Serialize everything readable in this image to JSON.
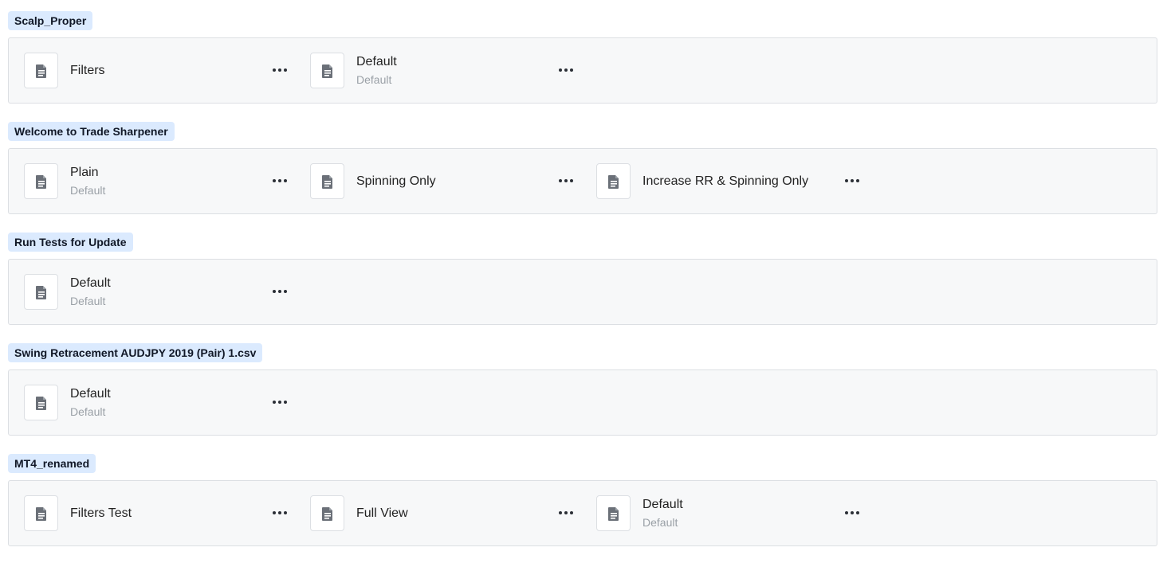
{
  "groups": [
    {
      "name": "Scalp_Proper",
      "items": [
        {
          "title": "Filters",
          "subtitle": ""
        },
        {
          "title": "Default",
          "subtitle": "Default"
        }
      ]
    },
    {
      "name": "Welcome to Trade Sharpener",
      "items": [
        {
          "title": "Plain",
          "subtitle": "Default"
        },
        {
          "title": "Spinning Only",
          "subtitle": ""
        },
        {
          "title": "Increase RR & Spinning Only",
          "subtitle": ""
        }
      ]
    },
    {
      "name": "Run Tests for Update",
      "items": [
        {
          "title": "Default",
          "subtitle": "Default"
        }
      ]
    },
    {
      "name": "Swing Retracement AUDJPY 2019 (Pair) 1.csv",
      "items": [
        {
          "title": "Default",
          "subtitle": "Default"
        }
      ]
    },
    {
      "name": "MT4_renamed",
      "items": [
        {
          "title": "Filters Test",
          "subtitle": ""
        },
        {
          "title": "Full View",
          "subtitle": ""
        },
        {
          "title": "Default",
          "subtitle": "Default"
        }
      ]
    }
  ],
  "icons": {
    "file": "document-icon",
    "more": "more-horizontal-icon"
  },
  "colors": {
    "tag_bg": "#dbeafe",
    "panel_bg": "#f7f8f9",
    "panel_border": "#dcdfe3",
    "icon_fill": "#6b7078"
  }
}
